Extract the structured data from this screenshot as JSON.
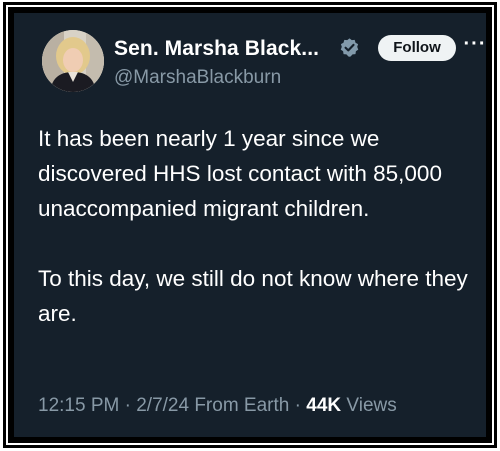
{
  "author": {
    "name": "Sen. Marsha Black...",
    "handle": "@MarshaBlackburn",
    "verified_color": "#829aab"
  },
  "actions": {
    "follow_label": "Follow",
    "more_label": "···"
  },
  "tweet": {
    "paragraphs": [
      "It has been nearly 1 year since we discovered HHS lost contact with 85,000 unaccompanied migrant children.",
      "To this day, we still do not know where they are."
    ]
  },
  "meta": {
    "time": "12:15 PM",
    "separator": "·",
    "date": "2/7/24",
    "source": "From Earth",
    "views_count": "44K",
    "views_label": "Views"
  },
  "colors": {
    "background": "#15202b",
    "text": "#ffffff",
    "secondary_text": "#8899a6",
    "follow_bg": "#eff3f4"
  }
}
